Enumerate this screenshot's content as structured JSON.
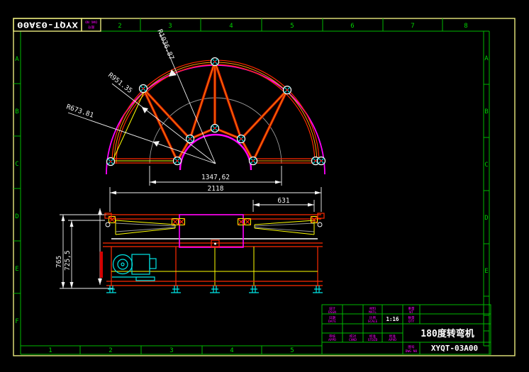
{
  "sheet": {
    "top_corner_label": "XYQT-03A00",
    "corner_stamp": {
      "cn": "图号",
      "en": "DWG NO"
    },
    "top_zones": [
      "2",
      "3",
      "4",
      "5",
      "6",
      "7",
      "8"
    ],
    "bottom_zones": [
      "1",
      "2",
      "3",
      "4",
      "5"
    ],
    "left_zones": [
      "A",
      "B",
      "C",
      "D",
      "E",
      "F"
    ],
    "right_zones": [
      "A",
      "B",
      "C",
      "D",
      "E"
    ],
    "colors": {
      "border": "#e9e97d",
      "grid": "#00b800",
      "truss_red": "#cf1400",
      "truss_core": "#ff9a00",
      "magenta": "#ff00ff",
      "cyan": "#00e5e5",
      "dim_white": "#f2f2f2",
      "ref_gray": "#9b9b9b",
      "yellow": "#ffff00"
    }
  },
  "plan_view": {
    "radius_outer": "R1036.87",
    "radius_mid": "R951.35",
    "radius_inner": "R673.81",
    "dim_diameter": "1347,62"
  },
  "side_view": {
    "dim_total_width": "2118",
    "dim_right_section": "631",
    "dim_height_outer": "765",
    "dim_height_inner": "725,5"
  },
  "title_block": {
    "title": "180度转弯机",
    "drawing_no": "XYQT-03A00",
    "scale_value": "1:16",
    "stamps": {
      "dsgn": {
        "cn": "设计",
        "en": "DSGN"
      },
      "matl": {
        "cn": "材料",
        "en": "MATL"
      },
      "wt": {
        "cn": "重量",
        "en": "WT"
      },
      "date": {
        "cn": "日期",
        "en": "DATE"
      },
      "scale": {
        "cn": "比例",
        "en": "SCALE"
      },
      "qty": {
        "cn": "数量",
        "en": "QTY"
      },
      "appd": {
        "cn": "审核",
        "en": "APPD"
      },
      "chkd": {
        "cn": "校对",
        "en": "CHKD"
      },
      "stdzd": {
        "cn": "标准",
        "en": "STDZD"
      },
      "apvd": {
        "cn": "批准",
        "en": "APVD"
      },
      "dwgno": {
        "cn": "图号",
        "en": "DWG NO"
      }
    }
  }
}
